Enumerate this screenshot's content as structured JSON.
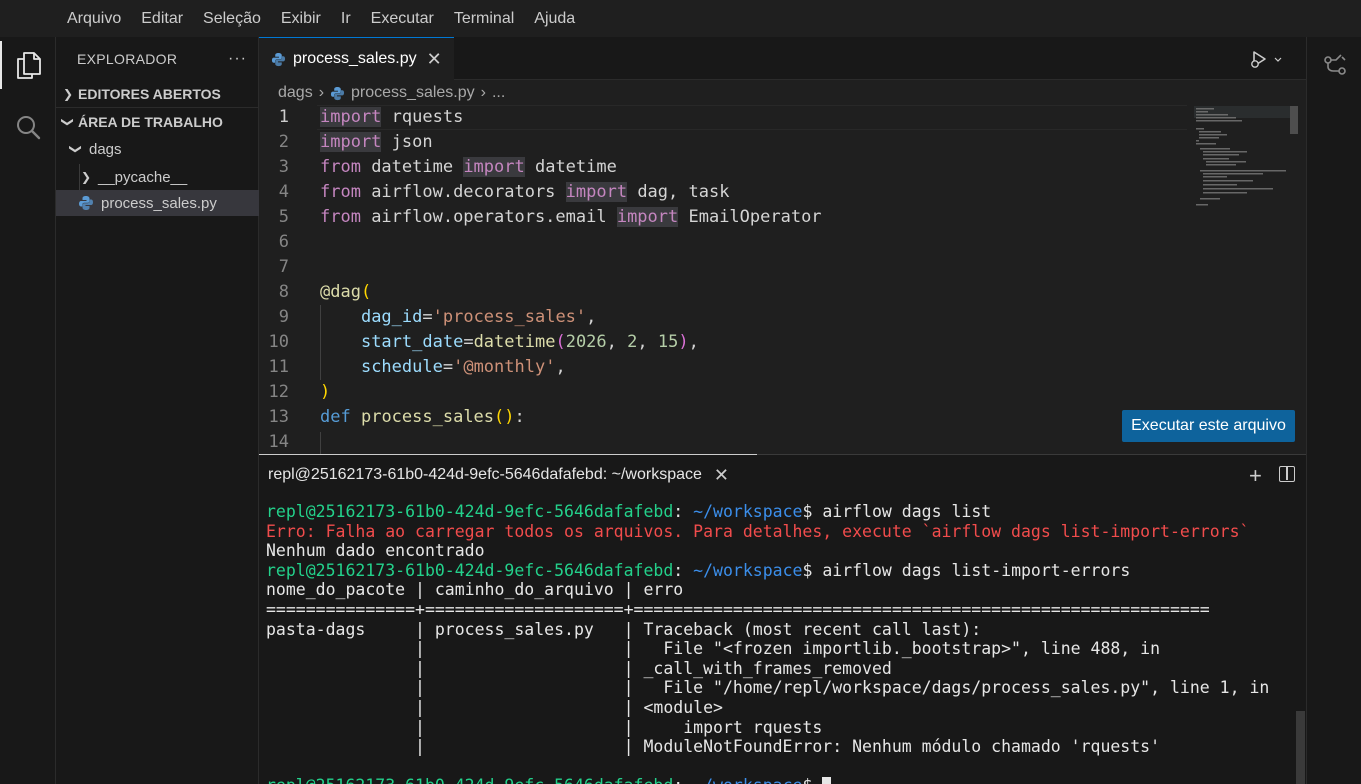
{
  "menu": [
    "Arquivo",
    "Editar",
    "Seleção",
    "Exibir",
    "Ir",
    "Executar",
    "Terminal",
    "Ajuda"
  ],
  "activity_bar": [
    {
      "icon": "files-icon",
      "active": true
    },
    {
      "icon": "search-icon",
      "active": false
    }
  ],
  "sidebar": {
    "title": "EXPLORADOR",
    "more": "···",
    "open_editors": "EDITORES ABERTOS",
    "workspace": "ÁREA DE TRABALHO",
    "folder": "dags",
    "subfolder": "__pycache__",
    "file": "process_sales.py"
  },
  "editor": {
    "tab_label": "process_sales.py",
    "breadcrumb": [
      "dags",
      "process_sales.py",
      "..."
    ],
    "line_numbers": [
      "1",
      "2",
      "3",
      "4",
      "5",
      "6",
      "7",
      "8",
      "9",
      "10",
      "11",
      "12",
      "13",
      "14"
    ],
    "run_file_label": "Executar este arquivo",
    "code": {
      "l1": {
        "kw": "import",
        "rest": " rquests"
      },
      "l2": {
        "kw": "import",
        "rest": " json"
      },
      "l3": {
        "a": "from",
        "b": " datetime ",
        "kw": "import",
        "c": " datetime"
      },
      "l4": {
        "a": "from",
        "b": " airflow.decorators ",
        "kw": "import",
        "c": " dag, task"
      },
      "l5": {
        "a": "from",
        "b": " airflow.operators.email ",
        "kw": "import",
        "c": " EmailOperator"
      },
      "l8": {
        "dec": "@dag",
        "paren": "("
      },
      "l9": {
        "indent": "    ",
        "param": "dag_id",
        "eq": "=",
        "str": "'process_sales'",
        "comma": ","
      },
      "l10": {
        "indent": "    ",
        "param": "start_date",
        "eq": "=",
        "fn": "datetime",
        "open": "(",
        "n1": "2026",
        "s1": ", ",
        "n2": "2",
        "s2": ", ",
        "n3": "15",
        "close": ")",
        "comma": ","
      },
      "l11": {
        "indent": "    ",
        "param": "schedule",
        "eq": "=",
        "str": "'@monthly'",
        "comma": ","
      },
      "l12": {
        "paren": ")"
      },
      "l13": {
        "def": "def",
        "sp": " ",
        "name": "process_sales",
        "parens": "()",
        "colon": ":"
      }
    }
  },
  "terminal": {
    "tab_title": "repl@25162173-61b0-424d-9efc-5646dafafebd: ~/workspace",
    "prompt_user": "repl@25162173-61b0-424d-9efc-5646dafafebd",
    "prompt_colon": ":",
    "prompt_path": " ~/workspace",
    "prompt_dollar": "$",
    "cmd1": " airflow dags list",
    "error_line": "Erro: Falha ao carregar todos os arquivos. Para detalhes, execute `airflow dags list-import-errors`",
    "no_data": "Nenhum dado encontrado",
    "cmd2": " airflow dags list-import-errors",
    "header": "nome_do_pacote | caminho_do_arquivo | erro",
    "separator": "===============+====================+==========================================================",
    "rows": [
      "pasta-dags     | process_sales.py   | Traceback (most recent call last):",
      "               |                    |   File \"<frozen importlib._bootstrap>\", line 488, in",
      "               |                    | _call_with_frames_removed",
      "               |                    |   File \"/home/repl/workspace/dags/process_sales.py\", line 1, in",
      "               |                    | <module>",
      "               |                    |     import rquests",
      "               |                    | ModuleNotFoundError: Nenhum módulo chamado 'rquests'"
    ]
  }
}
